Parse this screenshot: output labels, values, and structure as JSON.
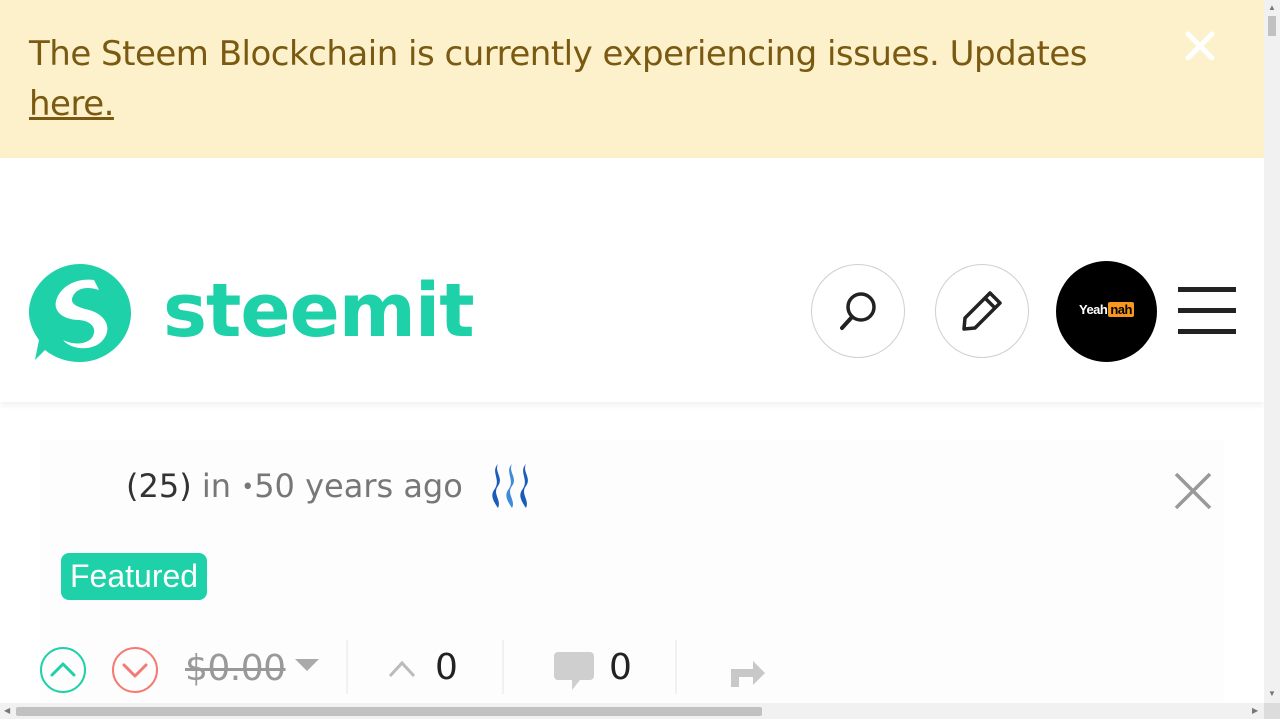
{
  "banner": {
    "message": "The Steem Blockchain is currently experiencing issues. Updates",
    "link_text": "here.",
    "close_icon": "close-icon"
  },
  "header": {
    "logo_text": "steemit",
    "logo_icon": "steemit-logo-icon",
    "search_icon": "search-icon",
    "compose_icon": "pencil-icon",
    "avatar_label_left": "Yeah",
    "avatar_label_right": "nah",
    "menu_icon": "hamburger-icon"
  },
  "post": {
    "reputation": "(25)",
    "category_prefix": "in",
    "separator": "•",
    "age": "50 years ago",
    "badge": "Featured",
    "payout": "$0.00",
    "votes_count": "0",
    "comments_count": "0"
  },
  "colors": {
    "brand": "#1fd1a8",
    "banner_bg": "#fdf1cb",
    "banner_text": "#7a5a12",
    "upvote": "#1fd1a8",
    "downvote": "#f47a74"
  }
}
